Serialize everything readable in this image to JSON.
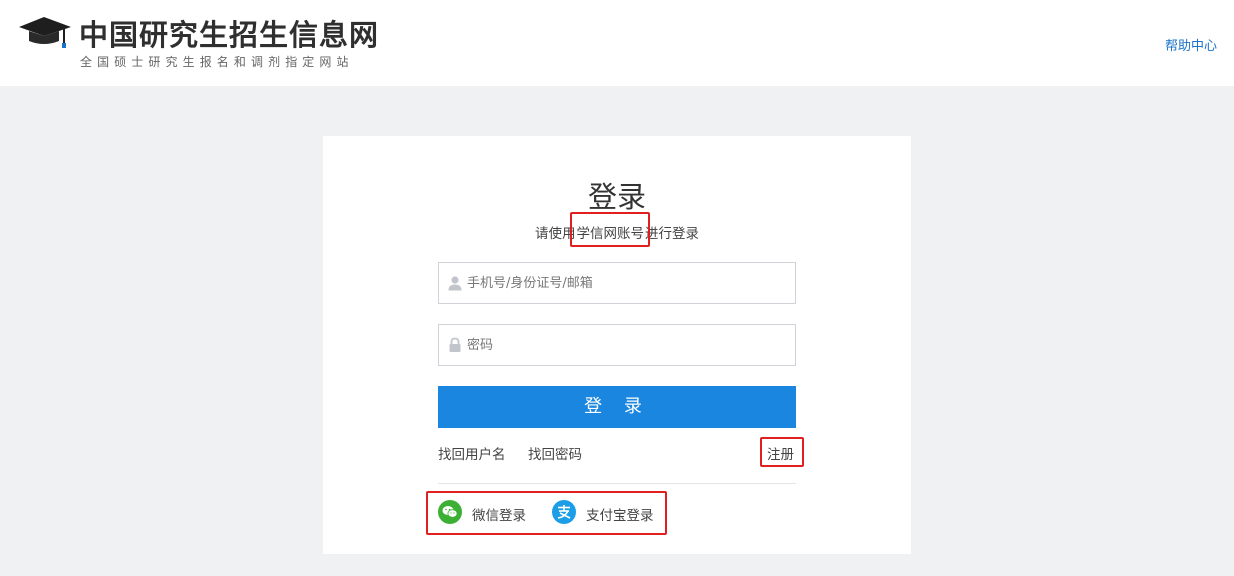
{
  "header": {
    "site_title": "中国研究生招生信息网",
    "site_subtitle": "全国硕士研究生报名和调剂指定网站",
    "help_link": "帮助中心",
    "logo_icon": "graduation-cap-icon"
  },
  "login": {
    "title": "登录",
    "tip_before": "请使用",
    "tip_account": "学信网账号",
    "tip_after": "进行登录",
    "username_placeholder": "手机号/身份证号/邮箱",
    "username_value": "",
    "username_icon": "user-icon",
    "password_placeholder": "密码",
    "password_value": "",
    "password_icon": "lock-icon",
    "submit_label": "登 录",
    "find_username": "找回用户名",
    "find_password": "找回密码",
    "register": "注册",
    "wechat_login": "微信登录",
    "wechat_icon": "wechat-icon",
    "alipay_login": "支付宝登录",
    "alipay_icon": "alipay-icon"
  },
  "colors": {
    "primary_button": "#1a86e0",
    "link": "#1a73c8",
    "annotation": "#e02020",
    "page_background": "#f0f1f3"
  }
}
